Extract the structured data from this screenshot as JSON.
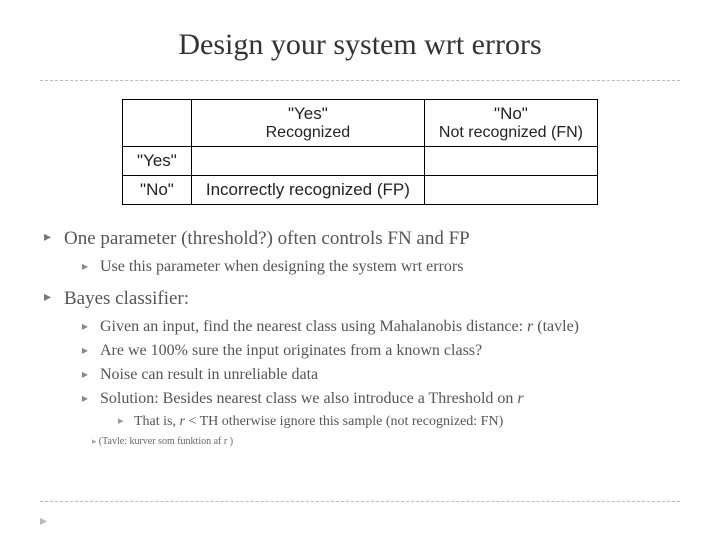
{
  "title": "Design your system wrt errors",
  "table": {
    "col1_header_main": "\"Yes\"",
    "col1_header_sub": "Recognized",
    "col2_header_main": "\"No\"",
    "col2_header_sub": "Not recognized (FN)",
    "row1_label": "\"Yes\"",
    "row2_label": "\"No\"",
    "row2_col1": "Incorrectly recognized (FP)"
  },
  "b1": {
    "text": "One parameter (threshold?) often controls FN and FP",
    "sub1": "Use this parameter when designing the system wrt errors"
  },
  "b2": {
    "text": "Bayes classifier:",
    "s1_a": "Given an input, find the nearest class using Mahalanobis distance:  ",
    "s1_var": "r",
    "s1_b": "  (tavle)",
    "s2": "Are we 100% sure the input originates from a known class?",
    "s3": "Noise can result in unreliable data",
    "s4_a": "Solution: Besides nearest class we also introduce a Threshold on ",
    "s4_var": "r",
    "s4_sub_a": "That is, ",
    "s4_sub_var": "r",
    "s4_sub_b": " < TH otherwise ignore this sample (not recognized: FN)"
  },
  "footnote": "(Tavle: kurver som funktion af r )"
}
